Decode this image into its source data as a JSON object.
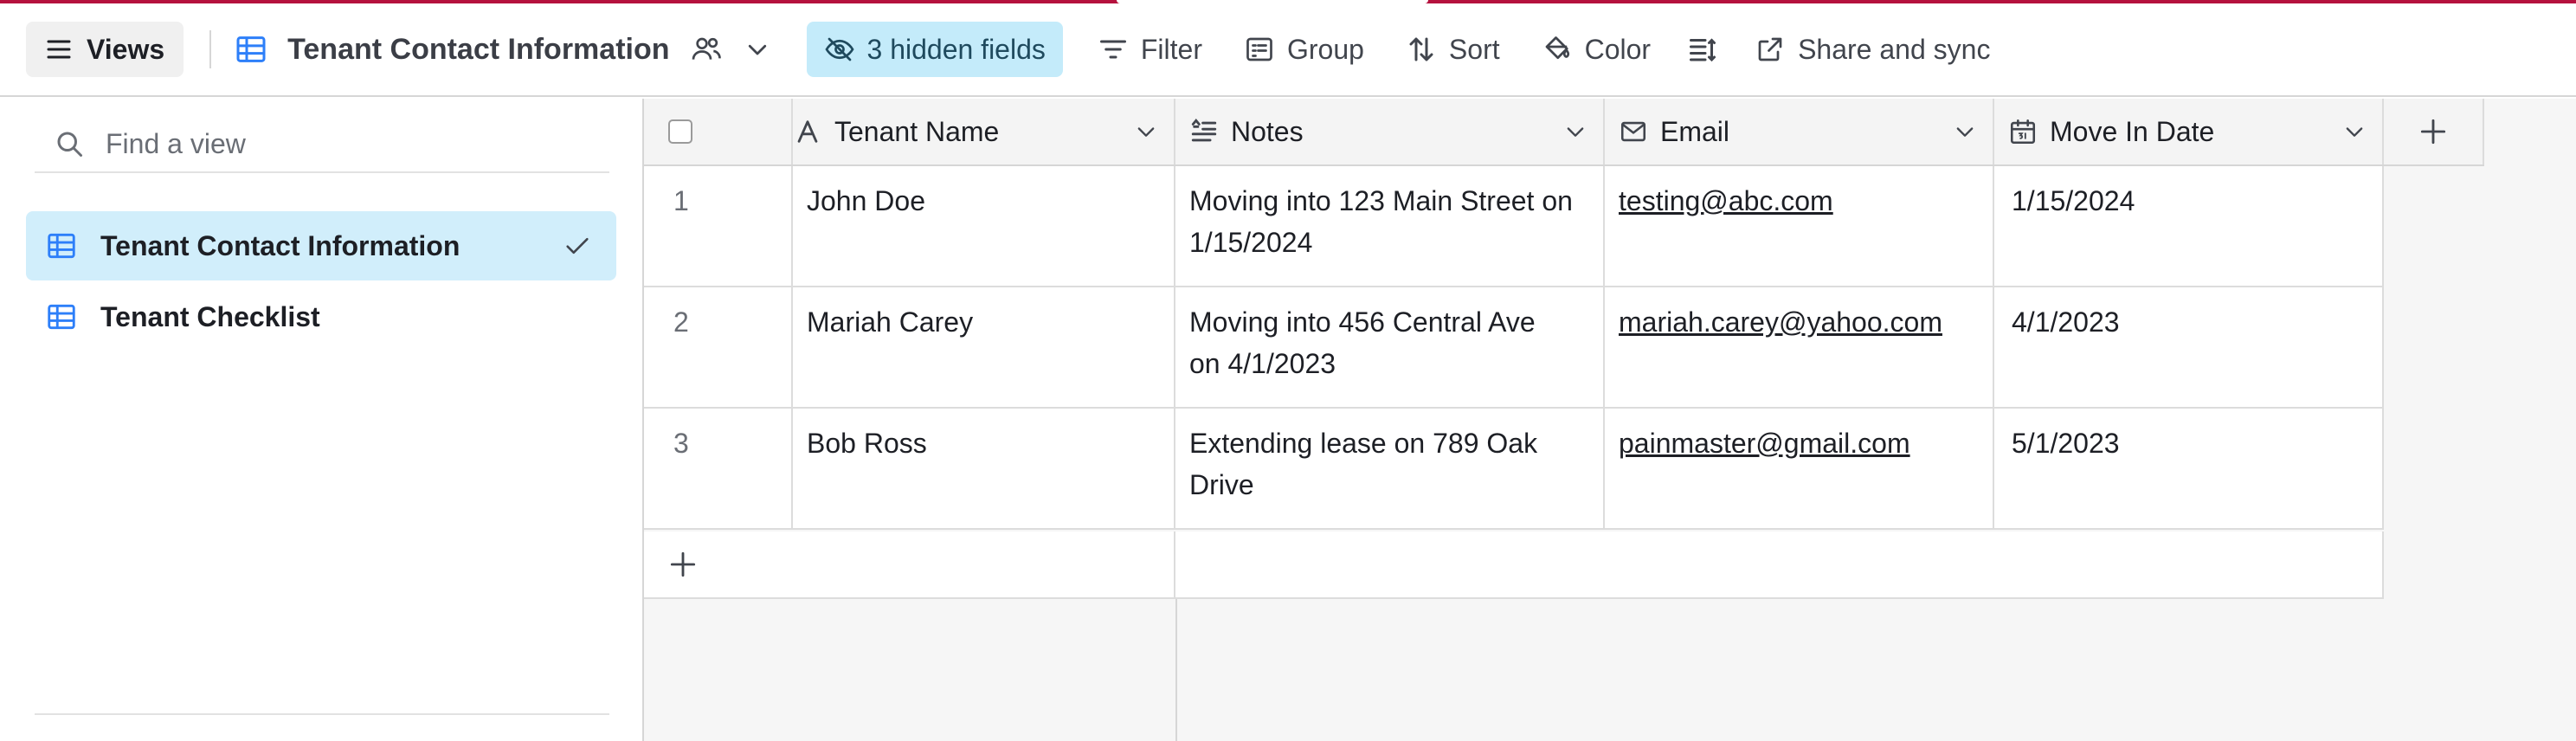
{
  "toolbar": {
    "views_label": "Views",
    "view_name": "Tenant Contact Information",
    "hidden_fields_label": "3 hidden fields",
    "filter_label": "Filter",
    "group_label": "Group",
    "sort_label": "Sort",
    "color_label": "Color",
    "share_label": "Share and sync"
  },
  "sidebar": {
    "search_placeholder": "Find a view",
    "views": [
      {
        "name": "Tenant Contact Information",
        "active": true
      },
      {
        "name": "Tenant Checklist",
        "active": false
      }
    ]
  },
  "grid": {
    "columns": [
      {
        "name": "Tenant Name",
        "icon": "text-field-icon"
      },
      {
        "name": "Notes",
        "icon": "long-text-icon"
      },
      {
        "name": "Email",
        "icon": "email-icon"
      },
      {
        "name": "Move In Date",
        "icon": "calendar-icon"
      }
    ],
    "rows": [
      {
        "num": "1",
        "name": "John Doe",
        "notes_line1": "Moving into 123 Main Street on",
        "notes_line2": "1/15/2024",
        "email": "testing@abc.com",
        "date": "1/15/2024"
      },
      {
        "num": "2",
        "name": "Mariah Carey",
        "notes_line1": "Moving into 456 Central Ave",
        "notes_line2": "on 4/1/2023",
        "email": "mariah.carey@yahoo.com",
        "date": "4/1/2023"
      },
      {
        "num": "3",
        "name": "Bob Ross",
        "notes_line1": "Extending lease on 789 Oak",
        "notes_line2": "Drive",
        "email": "painmaster@gmail.com",
        "date": "5/1/2023"
      }
    ]
  },
  "colors": {
    "accent_line": "#b5123e",
    "active_view_bg": "#d1eefb",
    "hidden_fields_bg": "#c4ebfa",
    "grid_icon": "#2d7ff9"
  }
}
